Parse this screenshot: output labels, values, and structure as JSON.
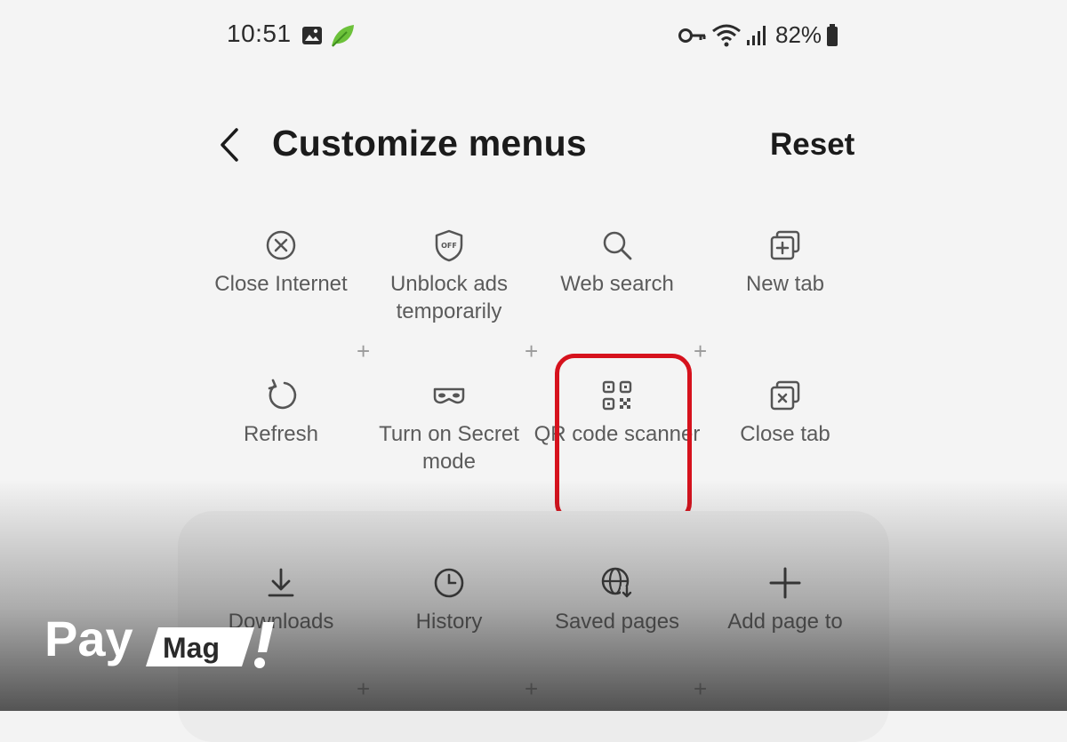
{
  "status_bar": {
    "time": "10:51",
    "battery": "82%",
    "icons": [
      "image-icon",
      "leaf-icon",
      "key-icon",
      "wifi-icon",
      "signal-icon",
      "battery-icon"
    ]
  },
  "header": {
    "title": "Customize menus",
    "reset_label": "Reset",
    "back_icon": "chevron-left-icon"
  },
  "menu_items": [
    {
      "label": "Close Internet",
      "icon": "close-circle-icon"
    },
    {
      "label": "Unblock ads temporarily",
      "icon": "shield-off-icon"
    },
    {
      "label": "Web search",
      "icon": "search-icon"
    },
    {
      "label": "New tab",
      "icon": "new-tab-icon"
    },
    {
      "label": "Refresh",
      "icon": "refresh-icon"
    },
    {
      "label": "Turn on Secret mode",
      "icon": "mask-icon"
    },
    {
      "label": "QR code scanner",
      "icon": "qr-code-icon"
    },
    {
      "label": "Close tab",
      "icon": "close-tab-icon"
    }
  ],
  "panel_items": [
    {
      "label": "Downloads",
      "icon": "download-icon"
    },
    {
      "label": "History",
      "icon": "clock-icon"
    },
    {
      "label": "Saved pages",
      "icon": "globe-download-icon"
    },
    {
      "label": "Add page to",
      "icon": "plus-icon"
    }
  ],
  "highlight_color": "#d6121d",
  "watermark": {
    "word1": "Pay",
    "word2": "Mag",
    "mark": "!"
  }
}
